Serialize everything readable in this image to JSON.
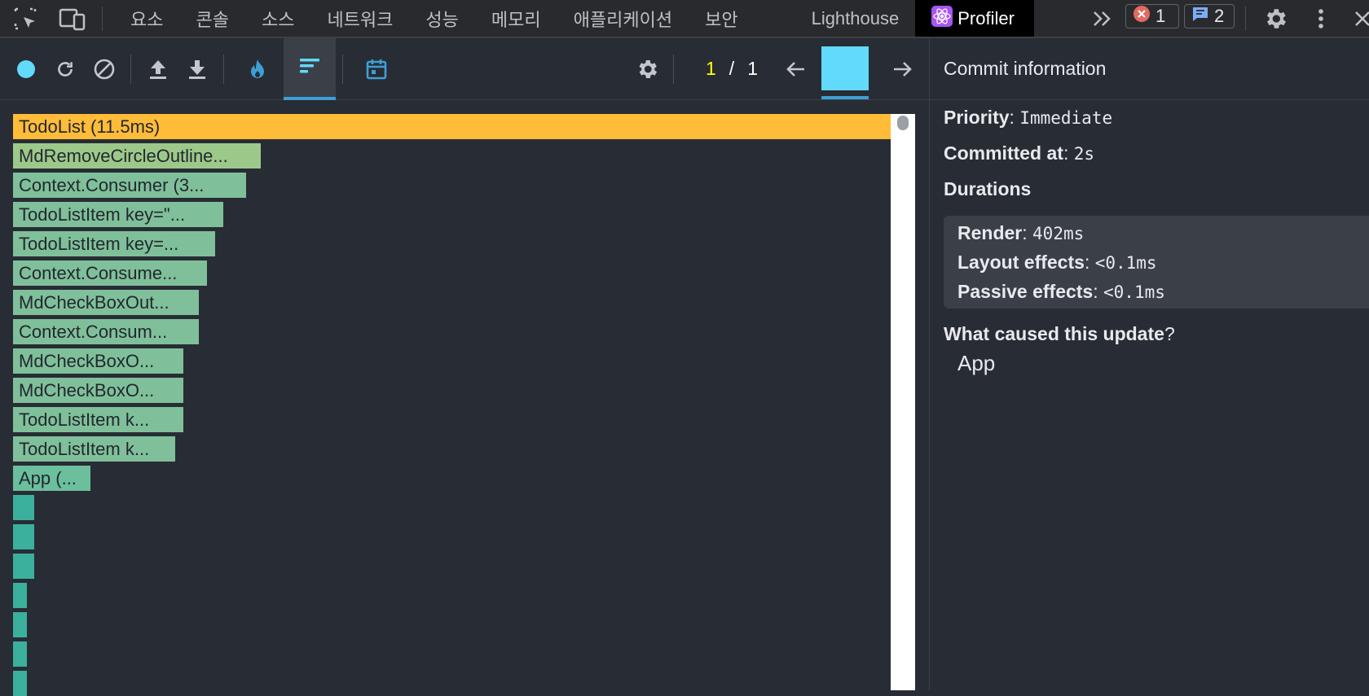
{
  "tabs": [
    "요소",
    "콘솔",
    "소스",
    "네트워크",
    "성능",
    "메모리",
    "애플리케이션",
    "보안",
    "Lighthouse",
    "Profiler"
  ],
  "errors_count": "1",
  "messages_count": "2",
  "commit_nav": {
    "current": "1",
    "separator": "/",
    "total": "1"
  },
  "sidebar": {
    "title": "Commit information",
    "priority_label": "Priority",
    "priority_value": "Immediate",
    "committed_label": "Committed at",
    "committed_value": "2s",
    "durations_label": "Durations",
    "render_label": "Render",
    "render_value": "402ms",
    "layout_label": "Layout effects",
    "layout_value": "<0.1ms",
    "passive_label": "Passive effects",
    "passive_value": "<0.1ms",
    "cause_label": "What caused this update",
    "cause_value": "App"
  },
  "ranked_bars": [
    {
      "label": "TodoList (11.5ms)",
      "color": "#ffbc39"
    },
    {
      "label": "MdRemoveCircleOutline...",
      "color": "#9cc98a"
    },
    {
      "label": "Context.Consumer (3...",
      "color": "#7fc09a"
    },
    {
      "label": "TodoListItem key=\"...",
      "color": "#7fc09a"
    },
    {
      "label": "TodoListItem key=...",
      "color": "#7fc09a"
    },
    {
      "label": "Context.Consume...",
      "color": "#7fc09a"
    },
    {
      "label": "MdCheckBoxOut...",
      "color": "#7fc09a"
    },
    {
      "label": "Context.Consum...",
      "color": "#7fc09a"
    },
    {
      "label": "MdCheckBoxO...",
      "color": "#7fc09a"
    },
    {
      "label": "MdCheckBoxO...",
      "color": "#7fc09a"
    },
    {
      "label": "TodoListItem k...",
      "color": "#7fc09a"
    },
    {
      "label": "TodoListItem k...",
      "color": "#7fc09a"
    },
    {
      "label": "App (...",
      "color": "#6cbf9c"
    },
    {
      "label": "",
      "color": "#3bb09c"
    },
    {
      "label": "",
      "color": "#3bb09c"
    },
    {
      "label": "",
      "color": "#3bb09c"
    },
    {
      "label": "",
      "color": "#3bb09c"
    },
    {
      "label": "",
      "color": "#3bb09c"
    },
    {
      "label": "",
      "color": "#3bb09c"
    },
    {
      "label": "",
      "color": "#3bb09c"
    }
  ],
  "colors": {
    "accent": "#61dafb",
    "commit_current": "#ffff00"
  }
}
